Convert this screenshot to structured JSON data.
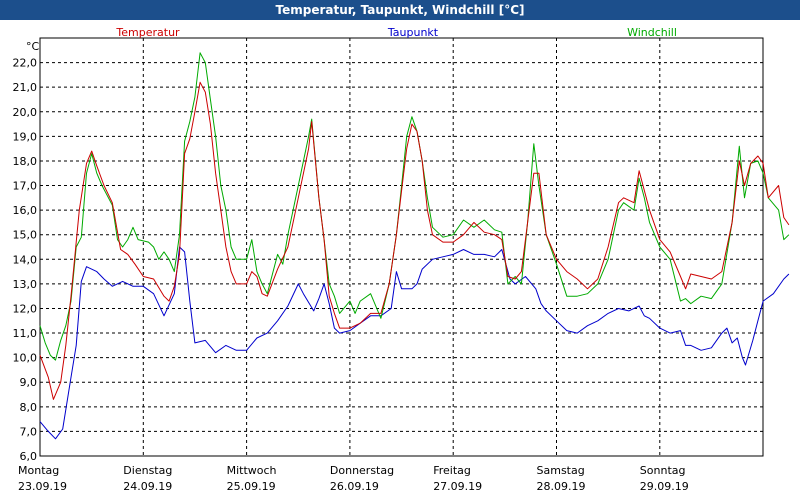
{
  "window": {
    "title": "Temperatur, Taupunkt, Windchill [°C]"
  },
  "colors": {
    "title_bar": "#1c4f8c",
    "temperatur": "#cc0000",
    "taupunkt": "#0000cc",
    "windchill": "#00aa00"
  },
  "chart_data": {
    "type": "line",
    "title": "Temperatur, Taupunkt, Windchill [°C]",
    "unit": "°C",
    "ylim": [
      6.0,
      23.0
    ],
    "yticks": [
      "6,0",
      "7,0",
      "8,0",
      "9,0",
      "10,0",
      "11,0",
      "12,0",
      "13,0",
      "14,0",
      "15,0",
      "16,0",
      "17,0",
      "18,0",
      "19,0",
      "20,0",
      "21,0",
      "22,0"
    ],
    "grid": true,
    "x_unit": "days since 23.09.19 00:00",
    "xlim": [
      0,
      7
    ],
    "day_labels": [
      {
        "day": "Montag",
        "date": "23.09.19"
      },
      {
        "day": "Dienstag",
        "date": "24.09.19"
      },
      {
        "day": "Mittwoch",
        "date": "25.09.19"
      },
      {
        "day": "Donnerstag",
        "date": "26.09.19"
      },
      {
        "day": "Freitag",
        "date": "27.09.19"
      },
      {
        "day": "Samstag",
        "date": "28.09.19"
      },
      {
        "day": "Sonntag",
        "date": "29.09.19"
      }
    ],
    "series": [
      {
        "name": "Temperatur",
        "color": "#cc0000",
        "points": [
          [
            0,
            10.1
          ],
          [
            0.08,
            9.2
          ],
          [
            0.13,
            8.3
          ],
          [
            0.2,
            9.0
          ],
          [
            0.25,
            10.5
          ],
          [
            0.3,
            12.5
          ],
          [
            0.38,
            16.0
          ],
          [
            0.45,
            17.9
          ],
          [
            0.5,
            18.4
          ],
          [
            0.55,
            17.8
          ],
          [
            0.62,
            17.0
          ],
          [
            0.7,
            16.3
          ],
          [
            0.78,
            14.4
          ],
          [
            0.85,
            14.2
          ],
          [
            0.92,
            13.8
          ],
          [
            1.0,
            13.3
          ],
          [
            1.1,
            13.2
          ],
          [
            1.2,
            12.5
          ],
          [
            1.25,
            12.3
          ],
          [
            1.3,
            12.9
          ],
          [
            1.35,
            14.2
          ],
          [
            1.4,
            18.3
          ],
          [
            1.45,
            18.9
          ],
          [
            1.5,
            20.0
          ],
          [
            1.55,
            21.2
          ],
          [
            1.6,
            20.8
          ],
          [
            1.65,
            19.5
          ],
          [
            1.7,
            17.5
          ],
          [
            1.75,
            16.0
          ],
          [
            1.8,
            14.5
          ],
          [
            1.85,
            13.5
          ],
          [
            1.9,
            13.0
          ],
          [
            2.0,
            13.0
          ],
          [
            2.05,
            13.5
          ],
          [
            2.1,
            13.3
          ],
          [
            2.15,
            12.6
          ],
          [
            2.2,
            12.5
          ],
          [
            2.3,
            13.6
          ],
          [
            2.4,
            14.5
          ],
          [
            2.5,
            16.5
          ],
          [
            2.6,
            18.5
          ],
          [
            2.63,
            19.6
          ],
          [
            2.7,
            16.5
          ],
          [
            2.75,
            14.8
          ],
          [
            2.8,
            12.5
          ],
          [
            2.85,
            11.8
          ],
          [
            2.9,
            11.2
          ],
          [
            3.0,
            11.2
          ],
          [
            3.1,
            11.4
          ],
          [
            3.2,
            11.8
          ],
          [
            3.3,
            11.8
          ],
          [
            3.38,
            13.0
          ],
          [
            3.45,
            15.0
          ],
          [
            3.5,
            16.8
          ],
          [
            3.55,
            18.5
          ],
          [
            3.6,
            19.5
          ],
          [
            3.65,
            19.2
          ],
          [
            3.7,
            18.0
          ],
          [
            3.75,
            16.0
          ],
          [
            3.8,
            15.0
          ],
          [
            3.9,
            14.7
          ],
          [
            4.0,
            14.7
          ],
          [
            4.1,
            15.0
          ],
          [
            4.2,
            15.5
          ],
          [
            4.3,
            15.1
          ],
          [
            4.4,
            15.0
          ],
          [
            4.47,
            14.8
          ],
          [
            4.53,
            13.3
          ],
          [
            4.6,
            13.2
          ],
          [
            4.66,
            13.5
          ],
          [
            4.72,
            15.5
          ],
          [
            4.78,
            17.5
          ],
          [
            4.83,
            17.5
          ],
          [
            4.9,
            15.0
          ],
          [
            5.0,
            14.0
          ],
          [
            5.1,
            13.5
          ],
          [
            5.2,
            13.2
          ],
          [
            5.3,
            12.8
          ],
          [
            5.4,
            13.2
          ],
          [
            5.5,
            14.5
          ],
          [
            5.6,
            16.3
          ],
          [
            5.65,
            16.5
          ],
          [
            5.75,
            16.3
          ],
          [
            5.8,
            17.6
          ],
          [
            5.85,
            16.8
          ],
          [
            5.9,
            16.0
          ],
          [
            6.0,
            14.8
          ],
          [
            6.1,
            14.3
          ],
          [
            6.2,
            13.3
          ],
          [
            6.25,
            12.8
          ],
          [
            6.3,
            13.4
          ],
          [
            6.4,
            13.3
          ],
          [
            6.5,
            13.2
          ],
          [
            6.6,
            13.5
          ],
          [
            6.7,
            15.5
          ],
          [
            6.77,
            18.0
          ],
          [
            6.82,
            17.0
          ],
          [
            6.88,
            17.9
          ],
          [
            6.95,
            18.2
          ],
          [
            7.0,
            17.9
          ],
          [
            7.05,
            16.5
          ],
          [
            7.15,
            17.0
          ],
          [
            7.2,
            15.7
          ],
          [
            7.25,
            15.4
          ]
        ]
      },
      {
        "name": "Taupunkt",
        "color": "#0000cc",
        "points": [
          [
            0,
            7.4
          ],
          [
            0.08,
            7.0
          ],
          [
            0.15,
            6.7
          ],
          [
            0.22,
            7.1
          ],
          [
            0.3,
            9.2
          ],
          [
            0.35,
            10.5
          ],
          [
            0.4,
            13.1
          ],
          [
            0.45,
            13.7
          ],
          [
            0.55,
            13.5
          ],
          [
            0.62,
            13.2
          ],
          [
            0.7,
            12.9
          ],
          [
            0.8,
            13.1
          ],
          [
            0.9,
            12.9
          ],
          [
            1.0,
            12.9
          ],
          [
            1.1,
            12.6
          ],
          [
            1.2,
            11.7
          ],
          [
            1.3,
            12.6
          ],
          [
            1.35,
            14.5
          ],
          [
            1.4,
            14.3
          ],
          [
            1.45,
            12.3
          ],
          [
            1.5,
            10.6
          ],
          [
            1.6,
            10.7
          ],
          [
            1.7,
            10.2
          ],
          [
            1.8,
            10.5
          ],
          [
            1.9,
            10.3
          ],
          [
            2.0,
            10.3
          ],
          [
            2.1,
            10.8
          ],
          [
            2.2,
            11.0
          ],
          [
            2.3,
            11.5
          ],
          [
            2.4,
            12.1
          ],
          [
            2.5,
            13.0
          ],
          [
            2.55,
            12.6
          ],
          [
            2.65,
            11.9
          ],
          [
            2.7,
            12.4
          ],
          [
            2.75,
            13.0
          ],
          [
            2.8,
            12.2
          ],
          [
            2.85,
            11.2
          ],
          [
            2.9,
            11.0
          ],
          [
            3.0,
            11.1
          ],
          [
            3.1,
            11.4
          ],
          [
            3.2,
            11.7
          ],
          [
            3.3,
            11.7
          ],
          [
            3.4,
            12.0
          ],
          [
            3.45,
            13.5
          ],
          [
            3.5,
            12.8
          ],
          [
            3.6,
            12.8
          ],
          [
            3.65,
            13.0
          ],
          [
            3.7,
            13.6
          ],
          [
            3.8,
            14.0
          ],
          [
            3.9,
            14.1
          ],
          [
            4.0,
            14.2
          ],
          [
            4.1,
            14.4
          ],
          [
            4.2,
            14.2
          ],
          [
            4.3,
            14.2
          ],
          [
            4.4,
            14.1
          ],
          [
            4.47,
            14.4
          ],
          [
            4.55,
            13.2
          ],
          [
            4.6,
            13.0
          ],
          [
            4.7,
            13.3
          ],
          [
            4.8,
            12.8
          ],
          [
            4.85,
            12.2
          ],
          [
            4.9,
            11.9
          ],
          [
            5.0,
            11.5
          ],
          [
            5.1,
            11.1
          ],
          [
            5.2,
            11.0
          ],
          [
            5.3,
            11.3
          ],
          [
            5.4,
            11.5
          ],
          [
            5.5,
            11.8
          ],
          [
            5.6,
            12.0
          ],
          [
            5.7,
            11.9
          ],
          [
            5.8,
            12.1
          ],
          [
            5.85,
            11.7
          ],
          [
            5.9,
            11.6
          ],
          [
            6.0,
            11.2
          ],
          [
            6.1,
            11.0
          ],
          [
            6.2,
            11.1
          ],
          [
            6.25,
            10.5
          ],
          [
            6.3,
            10.5
          ],
          [
            6.4,
            10.3
          ],
          [
            6.5,
            10.4
          ],
          [
            6.6,
            11.0
          ],
          [
            6.65,
            11.2
          ],
          [
            6.7,
            10.6
          ],
          [
            6.75,
            10.8
          ],
          [
            6.8,
            10.0
          ],
          [
            6.83,
            9.7
          ],
          [
            6.9,
            10.7
          ],
          [
            6.95,
            11.5
          ],
          [
            7.0,
            12.3
          ],
          [
            7.1,
            12.6
          ],
          [
            7.2,
            13.2
          ],
          [
            7.25,
            13.4
          ]
        ]
      },
      {
        "name": "Windchill",
        "color": "#00aa00",
        "points": [
          [
            0,
            11.3
          ],
          [
            0.05,
            10.6
          ],
          [
            0.1,
            10.1
          ],
          [
            0.15,
            9.9
          ],
          [
            0.2,
            10.7
          ],
          [
            0.25,
            11.3
          ],
          [
            0.3,
            12.3
          ],
          [
            0.35,
            14.5
          ],
          [
            0.4,
            14.9
          ],
          [
            0.45,
            17.5
          ],
          [
            0.5,
            18.3
          ],
          [
            0.55,
            17.5
          ],
          [
            0.6,
            17.0
          ],
          [
            0.7,
            16.2
          ],
          [
            0.75,
            14.8
          ],
          [
            0.8,
            14.5
          ],
          [
            0.85,
            14.8
          ],
          [
            0.9,
            15.3
          ],
          [
            0.95,
            14.8
          ],
          [
            1.05,
            14.7
          ],
          [
            1.1,
            14.5
          ],
          [
            1.15,
            14.0
          ],
          [
            1.2,
            14.3
          ],
          [
            1.25,
            14.0
          ],
          [
            1.3,
            13.5
          ],
          [
            1.35,
            15.0
          ],
          [
            1.4,
            18.8
          ],
          [
            1.45,
            19.6
          ],
          [
            1.5,
            20.6
          ],
          [
            1.55,
            22.4
          ],
          [
            1.6,
            22.0
          ],
          [
            1.65,
            20.5
          ],
          [
            1.7,
            19.0
          ],
          [
            1.75,
            17.0
          ],
          [
            1.8,
            16.0
          ],
          [
            1.85,
            14.5
          ],
          [
            1.9,
            14.0
          ],
          [
            2.0,
            14.0
          ],
          [
            2.05,
            14.8
          ],
          [
            2.1,
            13.5
          ],
          [
            2.15,
            13.0
          ],
          [
            2.2,
            12.6
          ],
          [
            2.3,
            14.2
          ],
          [
            2.35,
            13.8
          ],
          [
            2.4,
            15.0
          ],
          [
            2.5,
            17.0
          ],
          [
            2.6,
            19.0
          ],
          [
            2.63,
            19.7
          ],
          [
            2.7,
            16.5
          ],
          [
            2.75,
            14.8
          ],
          [
            2.8,
            13.0
          ],
          [
            2.85,
            12.5
          ],
          [
            2.9,
            11.8
          ],
          [
            3.0,
            12.3
          ],
          [
            3.05,
            11.8
          ],
          [
            3.1,
            12.3
          ],
          [
            3.2,
            12.6
          ],
          [
            3.3,
            11.6
          ],
          [
            3.38,
            13.0
          ],
          [
            3.45,
            15.0
          ],
          [
            3.5,
            17.0
          ],
          [
            3.55,
            19.0
          ],
          [
            3.6,
            19.8
          ],
          [
            3.65,
            19.2
          ],
          [
            3.7,
            18.0
          ],
          [
            3.75,
            16.5
          ],
          [
            3.8,
            15.3
          ],
          [
            3.9,
            14.9
          ],
          [
            4.0,
            15.0
          ],
          [
            4.1,
            15.6
          ],
          [
            4.2,
            15.3
          ],
          [
            4.3,
            15.6
          ],
          [
            4.4,
            15.2
          ],
          [
            4.47,
            15.1
          ],
          [
            4.53,
            13.0
          ],
          [
            4.6,
            13.3
          ],
          [
            4.66,
            13.0
          ],
          [
            4.72,
            15.5
          ],
          [
            4.78,
            18.7
          ],
          [
            4.83,
            17.0
          ],
          [
            4.9,
            15.0
          ],
          [
            5.0,
            13.8
          ],
          [
            5.1,
            12.5
          ],
          [
            5.2,
            12.5
          ],
          [
            5.3,
            12.6
          ],
          [
            5.4,
            13.0
          ],
          [
            5.5,
            14.0
          ],
          [
            5.6,
            16.0
          ],
          [
            5.65,
            16.3
          ],
          [
            5.75,
            16.0
          ],
          [
            5.8,
            17.3
          ],
          [
            5.85,
            16.5
          ],
          [
            5.9,
            15.5
          ],
          [
            6.0,
            14.5
          ],
          [
            6.1,
            14.0
          ],
          [
            6.2,
            12.3
          ],
          [
            6.25,
            12.4
          ],
          [
            6.3,
            12.2
          ],
          [
            6.4,
            12.5
          ],
          [
            6.5,
            12.4
          ],
          [
            6.6,
            13.0
          ],
          [
            6.7,
            15.5
          ],
          [
            6.77,
            18.6
          ],
          [
            6.82,
            16.5
          ],
          [
            6.88,
            17.9
          ],
          [
            6.95,
            18.0
          ],
          [
            7.0,
            17.5
          ],
          [
            7.05,
            16.5
          ],
          [
            7.15,
            16.0
          ],
          [
            7.2,
            14.8
          ],
          [
            7.25,
            15.0
          ]
        ]
      }
    ]
  }
}
